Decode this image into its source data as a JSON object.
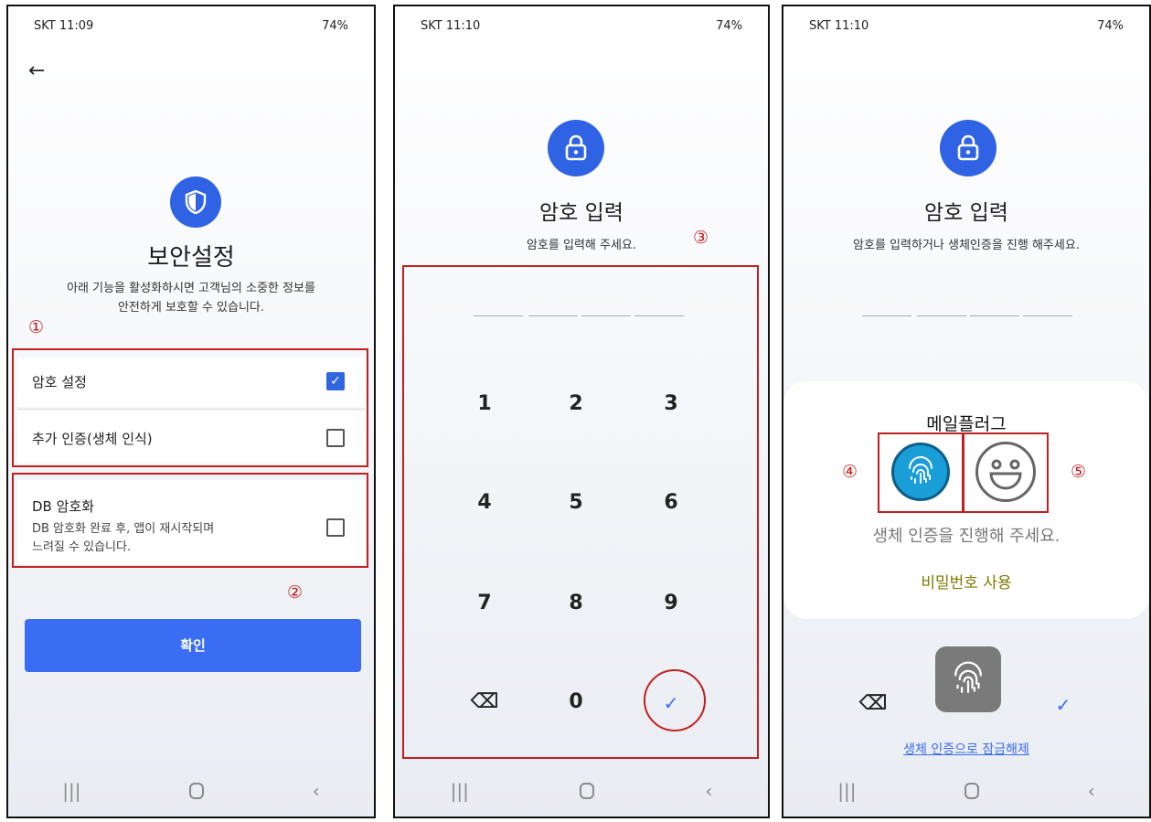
{
  "status_bar": [
    {
      "carrier_time": "SKT 11:09",
      "battery": "74%"
    },
    {
      "carrier_time": "SKT 11:10",
      "battery": "74%"
    },
    {
      "carrier_time": "SKT 11:10",
      "battery": "74%"
    }
  ],
  "screen1": {
    "title": "보안설정",
    "description_line1": "아래 기능을 활성화하시면 고객님의 소중한 정보를",
    "description_line2": "안전하게 보호할 수 있습니다.",
    "options": [
      {
        "label": "암호 설정",
        "checked": true
      },
      {
        "label": "추가 인증(생체 인식)",
        "checked": false
      },
      {
        "label": "DB 암호화",
        "sub_line1": "DB 암호화 완료 후, 앱이 재시작되며",
        "sub_line2": "느려질 수 있습니다.",
        "checked": false
      }
    ],
    "confirm_label": "확인"
  },
  "screen2": {
    "title": "암호 입력",
    "subtitle": "암호를 입력해 주세요.",
    "keys": [
      "1",
      "2",
      "3",
      "4",
      "5",
      "6",
      "7",
      "8",
      "9",
      "⌫",
      "0",
      "✓"
    ]
  },
  "screen3": {
    "title": "암호 입력",
    "subtitle": "암호를 입력하거나 생체인증을 진행 해주세요.",
    "app_name": "메일플러그",
    "bio_message": "생체 인증을 진행해 주세요.",
    "use_password": "비밀번호 사용",
    "unlock_link": "생체 인증으로 잠금해제"
  },
  "annotations": {
    "n1": "①",
    "n2": "②",
    "n3": "③",
    "n4": "④",
    "n5": "⑤"
  },
  "colors": {
    "accent": "#3a6cf4",
    "icon_blue": "#2f63e3",
    "annotation_red": "#c0201f",
    "fingerprint_blue": "#1a9ed8"
  }
}
